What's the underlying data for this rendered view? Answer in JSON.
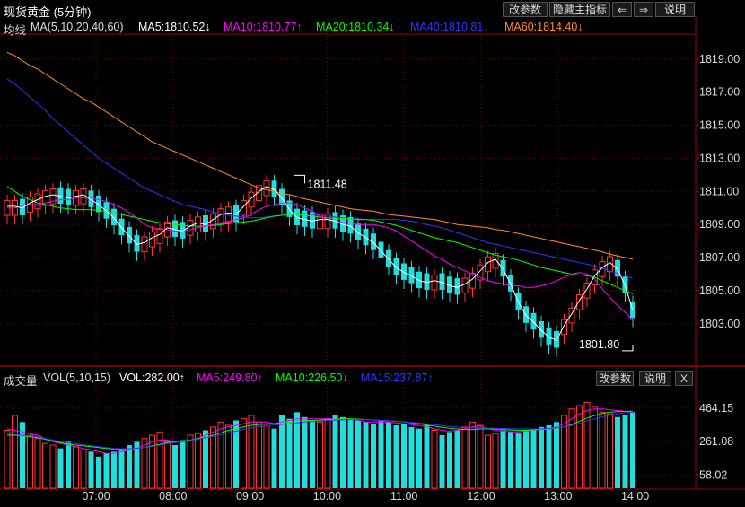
{
  "title": "现货黄金 (5分钟)",
  "toolbar": {
    "params_label": "改参数",
    "hide_label": "隐藏主指标",
    "prev_label": "⇐",
    "next_label": "⇒",
    "help_label": "说明"
  },
  "main_legend": {
    "prefix": "均线",
    "ma_label": "MA(5,10,20,40,60)",
    "items": [
      {
        "text": "MA5:1810.52↓",
        "color": "#ffffff"
      },
      {
        "text": "MA10:1810.77↑",
        "color": "#ff00ff"
      },
      {
        "text": "MA20:1810.34↓",
        "color": "#00ff00"
      },
      {
        "text": "MA40:1810.81↓",
        "color": "#3333ff"
      },
      {
        "text": "MA60:1814.40↓",
        "color": "#ff8c2a"
      }
    ]
  },
  "vol_legend": {
    "prefix": "成交量",
    "label": "VOL(5,10,15)",
    "items": [
      {
        "text": "VOL:282.00↑",
        "color": "#ffffff"
      },
      {
        "text": "MA5:249.80↑",
        "color": "#ff00ff"
      },
      {
        "text": "MA10:226.50↓",
        "color": "#00ff00"
      },
      {
        "text": "MA15:237.87↑",
        "color": "#3333ff"
      }
    ],
    "params_label": "改参数",
    "help_label": "说明",
    "close_label": "X"
  },
  "colors": {
    "up": "#ff3232",
    "down": "#22dddd",
    "grid": "#7a0000",
    "axis": "#a00000"
  },
  "chart_data": [
    {
      "type": "candlestick",
      "ylim": [
        1800.6,
        1820.4
      ],
      "yticks": [
        "1819.00",
        "1817.00",
        "1815.00",
        "1813.00",
        "1811.00",
        "1809.00",
        "1807.00",
        "1805.00",
        "1803.00"
      ],
      "xticks": [
        "07:00",
        "08:00",
        "09:00",
        "10:00",
        "11:00",
        "12:00",
        "13:00",
        "14:00"
      ],
      "annotations": [
        {
          "text": "1811.48",
          "price": 1811.48,
          "bar": 39
        },
        {
          "text": "1801.80",
          "price": 1801.8,
          "bar": 82
        }
      ],
      "series": [
        {
          "name": "MA60",
          "values": [
            1819.4,
            1819.2,
            1818.9,
            1818.6,
            1818.4,
            1818.1,
            1817.8,
            1817.5,
            1817.2,
            1816.9,
            1816.6,
            1816.4,
            1816.1,
            1815.8,
            1815.5,
            1815.2,
            1814.9,
            1814.6,
            1814.3,
            1814.0,
            1813.8,
            1813.6,
            1813.4,
            1813.2,
            1813.0,
            1812.8,
            1812.6,
            1812.4,
            1812.2,
            1812.0,
            1811.8,
            1811.6,
            1811.4,
            1811.2,
            1811.1,
            1811.0,
            1810.9,
            1810.8,
            1810.7,
            1810.55,
            1810.45,
            1810.35,
            1810.25,
            1810.15,
            1810.05,
            1809.95,
            1809.9,
            1809.85,
            1809.8,
            1809.7,
            1809.6,
            1809.55,
            1809.5,
            1809.45,
            1809.4,
            1809.35,
            1809.3,
            1809.2,
            1809.1,
            1809.0,
            1808.95,
            1808.9,
            1808.85,
            1808.8,
            1808.7,
            1808.65,
            1808.55,
            1808.45,
            1808.35,
            1808.25,
            1808.15,
            1808.05,
            1807.95,
            1807.85,
            1807.75,
            1807.65,
            1807.55,
            1807.45,
            1807.35,
            1807.2,
            1807.1,
            1807.0,
            1806.9
          ]
        },
        {
          "name": "MA40",
          "values": [
            1817.8,
            1817.5,
            1817.1,
            1816.7,
            1816.3,
            1815.9,
            1815.4,
            1815.0,
            1814.6,
            1814.2,
            1813.8,
            1813.4,
            1813.0,
            1812.7,
            1812.4,
            1812.1,
            1811.8,
            1811.5,
            1811.2,
            1811.0,
            1810.8,
            1810.6,
            1810.4,
            1810.2,
            1810.1,
            1810.0,
            1809.9,
            1809.75,
            1809.65,
            1809.55,
            1809.5,
            1809.45,
            1809.4,
            1809.4,
            1809.45,
            1809.5,
            1809.55,
            1809.6,
            1809.65,
            1809.65,
            1809.6,
            1809.55,
            1809.5,
            1809.45,
            1809.4,
            1809.35,
            1809.35,
            1809.3,
            1809.3,
            1809.3,
            1809.3,
            1809.3,
            1809.25,
            1809.2,
            1809.1,
            1809.0,
            1808.9,
            1808.8,
            1808.65,
            1808.5,
            1808.35,
            1808.2,
            1808.05,
            1807.9,
            1807.8,
            1807.7,
            1807.6,
            1807.5,
            1807.4,
            1807.3,
            1807.2,
            1807.1,
            1807.0,
            1806.9,
            1806.8,
            1806.7,
            1806.6,
            1806.5,
            1806.35,
            1806.2,
            1806.05,
            1805.9,
            1805.75
          ]
        },
        {
          "name": "MA20",
          "values": [
            1811.3,
            1811.0,
            1810.7,
            1810.5,
            1810.3,
            1810.2,
            1810.1,
            1810.0,
            1809.95,
            1809.9,
            1809.9,
            1809.9,
            1809.85,
            1809.8,
            1809.7,
            1809.6,
            1809.5,
            1809.4,
            1809.3,
            1809.2,
            1809.1,
            1809.05,
            1809.0,
            1808.95,
            1808.9,
            1808.9,
            1808.9,
            1808.95,
            1809.0,
            1809.05,
            1809.1,
            1809.15,
            1809.2,
            1809.3,
            1809.4,
            1809.5,
            1809.55,
            1809.6,
            1809.6,
            1809.55,
            1809.5,
            1809.45,
            1809.4,
            1809.35,
            1809.35,
            1809.35,
            1809.3,
            1809.3,
            1809.25,
            1809.15,
            1809.05,
            1808.95,
            1808.8,
            1808.65,
            1808.5,
            1808.35,
            1808.2,
            1808.1,
            1808.0,
            1807.9,
            1807.75,
            1807.6,
            1807.45,
            1807.3,
            1807.15,
            1807.05,
            1806.95,
            1806.85,
            1806.7,
            1806.55,
            1806.4,
            1806.3,
            1806.2,
            1806.1,
            1806.0,
            1805.95,
            1805.9,
            1805.8,
            1805.6,
            1805.4,
            1805.2,
            1805.0,
            1804.8
          ]
        },
        {
          "name": "MA10",
          "values": [
            1810.0,
            1810.0,
            1810.1,
            1810.2,
            1810.2,
            1810.3,
            1810.4,
            1810.5,
            1810.5,
            1810.6,
            1810.6,
            1810.6,
            1810.5,
            1810.4,
            1810.2,
            1810.0,
            1809.7,
            1809.4,
            1809.0,
            1808.8,
            1808.7,
            1808.7,
            1808.6,
            1808.6,
            1808.7,
            1808.8,
            1808.9,
            1809.0,
            1809.1,
            1809.2,
            1809.3,
            1809.4,
            1809.6,
            1809.9,
            1810.1,
            1810.2,
            1810.3,
            1810.3,
            1810.2,
            1810.0,
            1809.8,
            1809.5,
            1809.3,
            1809.2,
            1809.1,
            1809.1,
            1809.0,
            1809.0,
            1809.0,
            1808.9,
            1808.8,
            1808.6,
            1808.3,
            1808.0,
            1807.7,
            1807.4,
            1807.1,
            1806.9,
            1806.6,
            1806.4,
            1806.2,
            1806.0,
            1805.8,
            1805.6,
            1805.5,
            1805.4,
            1805.3,
            1805.3,
            1805.2,
            1805.2,
            1805.3,
            1805.4,
            1805.6,
            1805.8,
            1806.0,
            1806.1,
            1806.0,
            1805.7,
            1805.1,
            1804.6,
            1804.1,
            1803.7,
            1803.2
          ]
        },
        {
          "name": "MA5",
          "values": [
            1810.1,
            1810.1,
            1810.0,
            1810.3,
            1810.5,
            1810.7,
            1810.8,
            1810.7,
            1810.6,
            1810.7,
            1810.8,
            1810.5,
            1810.2,
            1809.8,
            1809.4,
            1808.8,
            1808.3,
            1807.8,
            1807.9,
            1808.2,
            1808.4,
            1808.8,
            1808.7,
            1808.6,
            1808.9,
            1809.1,
            1809.0,
            1809.3,
            1809.6,
            1809.7,
            1809.6,
            1810.1,
            1810.6,
            1811.0,
            1811.3,
            1811.1,
            1810.6,
            1809.9,
            1809.4,
            1809.3,
            1809.2,
            1809.3,
            1809.3,
            1809.2,
            1809.0,
            1808.9,
            1808.5,
            1808.2,
            1807.9,
            1807.4,
            1806.9,
            1806.4,
            1806.1,
            1805.9,
            1805.6,
            1805.5,
            1805.6,
            1805.5,
            1805.3,
            1805.2,
            1805.4,
            1805.7,
            1806.2,
            1806.7,
            1806.9,
            1806.3,
            1805.4,
            1804.3,
            1803.5,
            1803.1,
            1802.6,
            1802.2,
            1802.0,
            1802.9,
            1803.6,
            1804.4,
            1805.1,
            1805.9,
            1806.4,
            1806.7,
            1806.3,
            1805.3,
            1803.8
          ]
        }
      ]
    },
    {
      "type": "bar",
      "ylim": [
        0,
        600
      ],
      "yticks": [
        "464.15",
        "261.08",
        "58.02"
      ],
      "annotations": [
        {
          "text": "MA15:237.87↑",
          "value": 237.87
        }
      ],
      "series": [
        {
          "name": "VOL",
          "values": [
            330,
            420,
            380,
            300,
            280,
            250,
            240,
            220,
            260,
            230,
            210,
            200,
            170,
            190,
            200,
            220,
            240,
            260,
            280,
            300,
            320,
            260,
            240,
            270,
            300,
            310,
            330,
            350,
            380,
            360,
            390,
            400,
            420,
            380,
            360,
            340,
            420,
            400,
            440,
            410,
            390,
            380,
            400,
            420,
            410,
            400,
            390,
            380,
            370,
            390,
            380,
            360,
            370,
            350,
            340,
            360,
            330,
            300,
            320,
            330,
            350,
            380,
            360,
            300,
            310,
            330,
            320,
            310,
            330,
            340,
            350,
            360,
            380,
            420,
            460,
            480,
            500,
            470,
            440,
            430,
            410,
            420,
            440
          ]
        },
        {
          "name": "MA5",
          "values": [
            340,
            330,
            320,
            310,
            300,
            280,
            260,
            250,
            240,
            230,
            220,
            210,
            200,
            190,
            190,
            200,
            210,
            220,
            240,
            260,
            270,
            270,
            260,
            260,
            270,
            280,
            300,
            320,
            340,
            350,
            360,
            370,
            380,
            380,
            380,
            370,
            380,
            390,
            400,
            400,
            400,
            400,
            400,
            400,
            400,
            400,
            390,
            380,
            380,
            380,
            380,
            375,
            370,
            365,
            360,
            350,
            340,
            330,
            325,
            330,
            340,
            350,
            355,
            340,
            330,
            325,
            320,
            320,
            325,
            330,
            335,
            340,
            350,
            370,
            400,
            430,
            450,
            460,
            460,
            455,
            450,
            445,
            440
          ]
        },
        {
          "name": "MA10",
          "values": [
            300,
            300,
            295,
            290,
            285,
            275,
            265,
            255,
            245,
            240,
            235,
            230,
            225,
            220,
            215,
            215,
            215,
            220,
            225,
            235,
            245,
            255,
            260,
            265,
            270,
            280,
            290,
            300,
            315,
            330,
            340,
            350,
            360,
            365,
            370,
            370,
            375,
            380,
            385,
            390,
            390,
            392,
            395,
            398,
            400,
            400,
            398,
            395,
            392,
            390,
            388,
            385,
            380,
            375,
            370,
            362,
            355,
            348,
            342,
            338,
            335,
            335,
            338,
            340,
            338,
            335,
            332,
            330,
            330,
            332,
            335,
            338,
            342,
            350,
            365,
            385,
            405,
            420,
            432,
            440,
            443,
            445,
            446
          ]
        },
        {
          "name": "MA15",
          "values": [
            310,
            305,
            300,
            295,
            290,
            280,
            270,
            262,
            255,
            248,
            242,
            236,
            230,
            225,
            220,
            218,
            218,
            220,
            225,
            232,
            240,
            248,
            255,
            262,
            268,
            276,
            284,
            293,
            303,
            314,
            325,
            335,
            345,
            352,
            358,
            362,
            366,
            370,
            375,
            380,
            383,
            386,
            389,
            392,
            394,
            395,
            395,
            394,
            392,
            390,
            388,
            385,
            382,
            378,
            374,
            369,
            364,
            359,
            354,
            350,
            346,
            344,
            343,
            343,
            342,
            341,
            340,
            339,
            338,
            338,
            339,
            341,
            344,
            350,
            360,
            372,
            386,
            400,
            412,
            422,
            430,
            436,
            440
          ]
        }
      ]
    }
  ]
}
